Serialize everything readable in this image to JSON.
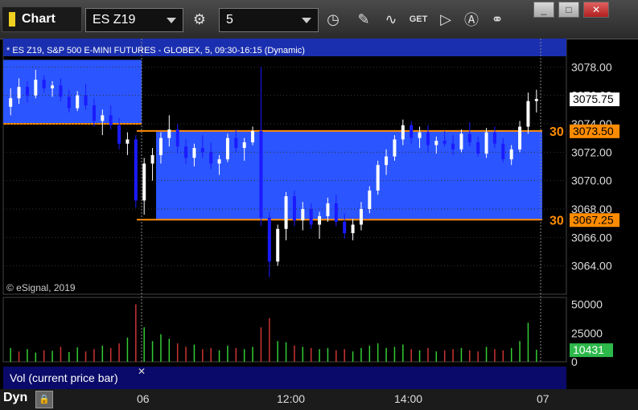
{
  "app": {
    "title": "Chart"
  },
  "toolbar": {
    "symbol": "ES Z19",
    "interval": "5",
    "window_buttons": [
      "_",
      "□",
      "✕"
    ]
  },
  "chart": {
    "description": "* ES Z19, S&P 500 E-MINI FUTURES - GLOBEX, 5, 09:30-16:15 (Dynamic)",
    "copyright": "© eSignal, 2019",
    "price_axis": {
      "ticks": [
        "3078.00",
        "3076.00",
        "3074.00",
        "3072.00",
        "3070.00",
        "3068.00",
        "3066.00",
        "3064.00"
      ],
      "min": 3062,
      "max": 3080
    },
    "current_price": "3075.75",
    "levels": [
      {
        "label": "30",
        "price": "3073.50",
        "value": 3073.5
      },
      {
        "label": "30",
        "price": "3067.25",
        "value": 3067.25
      }
    ],
    "volume_axis": {
      "ticks": [
        "50000",
        "25000",
        "0"
      ],
      "current": "10431"
    },
    "time_labels": [
      "06",
      "12:00",
      "14:00",
      "07"
    ],
    "colors": {
      "zone": "#2b55ff",
      "level": "#ff8c00",
      "up": "#ffffff",
      "down": "#1a1aff",
      "vol_up": "#3c3",
      "vol_down": "#c33"
    }
  },
  "chart_data": {
    "type": "candlestick",
    "candles": [
      [
        3075.2,
        3076.5,
        3074.6,
        3075.8
      ],
      [
        3075.8,
        3077.2,
        3075.4,
        3076.6
      ],
      [
        3076.6,
        3077.0,
        3075.5,
        3076.0
      ],
      [
        3076.0,
        3077.8,
        3075.8,
        3077.1
      ],
      [
        3077.1,
        3077.4,
        3076.2,
        3076.5
      ],
      [
        3076.5,
        3077.0,
        3075.9,
        3076.7
      ],
      [
        3076.7,
        3077.2,
        3075.6,
        3075.9
      ],
      [
        3075.9,
        3076.4,
        3074.8,
        3075.1
      ],
      [
        3075.1,
        3076.3,
        3074.9,
        3076.0
      ],
      [
        3076.0,
        3076.8,
        3075.0,
        3075.3
      ],
      [
        3075.3,
        3075.8,
        3073.8,
        3074.2
      ],
      [
        3074.2,
        3075.0,
        3073.2,
        3074.6
      ],
      [
        3074.6,
        3075.3,
        3073.6,
        3073.9
      ],
      [
        3073.9,
        3074.4,
        3072.2,
        3072.6
      ],
      [
        3072.6,
        3073.4,
        3071.8,
        3072.9
      ],
      [
        3072.9,
        3073.2,
        3068.1,
        3068.6
      ],
      [
        3068.6,
        3071.6,
        3067.6,
        3071.2
      ],
      [
        3071.2,
        3072.3,
        3070.0,
        3071.8
      ],
      [
        3071.8,
        3073.4,
        3071.2,
        3073.0
      ],
      [
        3073.0,
        3074.6,
        3072.4,
        3073.6
      ],
      [
        3073.6,
        3074.0,
        3071.9,
        3072.4
      ],
      [
        3072.4,
        3072.9,
        3071.2,
        3071.6
      ],
      [
        3071.6,
        3072.6,
        3071.0,
        3072.3
      ],
      [
        3072.3,
        3073.2,
        3071.6,
        3072.0
      ],
      [
        3072.0,
        3072.7,
        3070.8,
        3071.2
      ],
      [
        3071.2,
        3071.8,
        3070.4,
        3071.5
      ],
      [
        3071.5,
        3073.3,
        3071.3,
        3073.0
      ],
      [
        3073.0,
        3073.6,
        3072.0,
        3072.3
      ],
      [
        3072.3,
        3073.0,
        3071.4,
        3072.7
      ],
      [
        3072.7,
        3073.8,
        3072.5,
        3073.5
      ],
      [
        3073.5,
        3078.0,
        3066.8,
        3067.4
      ],
      [
        3067.4,
        3067.8,
        3063.2,
        3064.3
      ],
      [
        3064.3,
        3066.9,
        3064.0,
        3066.6
      ],
      [
        3066.6,
        3069.2,
        3065.8,
        3068.9
      ],
      [
        3068.9,
        3069.3,
        3066.8,
        3067.2
      ],
      [
        3067.2,
        3068.5,
        3066.5,
        3068.0
      ],
      [
        3068.0,
        3068.4,
        3066.6,
        3066.9
      ],
      [
        3066.9,
        3067.8,
        3065.9,
        3067.5
      ],
      [
        3067.5,
        3068.8,
        3067.1,
        3068.4
      ],
      [
        3068.4,
        3069.0,
        3066.8,
        3067.1
      ],
      [
        3067.1,
        3067.7,
        3065.9,
        3066.3
      ],
      [
        3066.3,
        3067.3,
        3065.8,
        3066.9
      ],
      [
        3066.9,
        3068.5,
        3066.5,
        3068.0
      ],
      [
        3068.0,
        3069.6,
        3067.7,
        3069.3
      ],
      [
        3069.3,
        3071.4,
        3069.0,
        3071.1
      ],
      [
        3071.1,
        3072.2,
        3070.4,
        3071.7
      ],
      [
        3071.7,
        3073.2,
        3071.4,
        3072.9
      ],
      [
        3072.9,
        3074.3,
        3072.5,
        3073.9
      ],
      [
        3073.9,
        3074.2,
        3072.6,
        3073.0
      ],
      [
        3073.0,
        3073.8,
        3072.3,
        3073.4
      ],
      [
        3073.4,
        3073.9,
        3072.0,
        3072.5
      ],
      [
        3072.5,
        3073.1,
        3071.9,
        3072.8
      ],
      [
        3072.8,
        3073.5,
        3072.4,
        3072.6
      ],
      [
        3072.6,
        3073.2,
        3071.8,
        3072.2
      ],
      [
        3072.2,
        3073.6,
        3072.0,
        3073.3
      ],
      [
        3073.3,
        3074.1,
        3072.4,
        3072.7
      ],
      [
        3072.7,
        3073.1,
        3071.7,
        3071.9
      ],
      [
        3071.9,
        3073.7,
        3071.6,
        3073.4
      ],
      [
        3073.4,
        3073.8,
        3072.3,
        3072.6
      ],
      [
        3072.6,
        3073.0,
        3071.3,
        3071.5
      ],
      [
        3071.5,
        3072.5,
        3071.1,
        3072.2
      ],
      [
        3072.2,
        3074.2,
        3072.0,
        3073.8
      ],
      [
        3073.8,
        3076.2,
        3073.3,
        3075.6
      ],
      [
        3075.6,
        3076.4,
        3074.8,
        3075.75
      ]
    ],
    "volume": [
      [
        12000,
        1
      ],
      [
        9000,
        0
      ],
      [
        11000,
        1
      ],
      [
        8000,
        1
      ],
      [
        10000,
        0
      ],
      [
        9500,
        1
      ],
      [
        13000,
        0
      ],
      [
        8500,
        1
      ],
      [
        12500,
        1
      ],
      [
        9000,
        0
      ],
      [
        11000,
        0
      ],
      [
        14000,
        1
      ],
      [
        12000,
        0
      ],
      [
        16000,
        0
      ],
      [
        21000,
        1
      ],
      [
        50000,
        0
      ],
      [
        30000,
        1
      ],
      [
        18000,
        1
      ],
      [
        24000,
        1
      ],
      [
        20000,
        1
      ],
      [
        16000,
        0
      ],
      [
        13000,
        0
      ],
      [
        15000,
        1
      ],
      [
        11000,
        0
      ],
      [
        12000,
        0
      ],
      [
        10000,
        1
      ],
      [
        14000,
        1
      ],
      [
        12000,
        0
      ],
      [
        11000,
        1
      ],
      [
        13000,
        1
      ],
      [
        30000,
        0
      ],
      [
        38000,
        0
      ],
      [
        18000,
        1
      ],
      [
        17000,
        1
      ],
      [
        14000,
        0
      ],
      [
        13000,
        1
      ],
      [
        12000,
        0
      ],
      [
        11000,
        1
      ],
      [
        12000,
        1
      ],
      [
        10000,
        0
      ],
      [
        11000,
        0
      ],
      [
        9000,
        1
      ],
      [
        12000,
        1
      ],
      [
        14000,
        1
      ],
      [
        16000,
        1
      ],
      [
        12000,
        1
      ],
      [
        13000,
        1
      ],
      [
        15000,
        1
      ],
      [
        11000,
        0
      ],
      [
        10000,
        1
      ],
      [
        12000,
        0
      ],
      [
        9000,
        1
      ],
      [
        10000,
        0
      ],
      [
        11000,
        0
      ],
      [
        12000,
        1
      ],
      [
        10000,
        0
      ],
      [
        9000,
        0
      ],
      [
        13000,
        1
      ],
      [
        11000,
        0
      ],
      [
        10000,
        0
      ],
      [
        12000,
        1
      ],
      [
        18000,
        1
      ],
      [
        34000,
        1
      ],
      [
        10431,
        1
      ]
    ],
    "ylim": [
      3062,
      3080
    ]
  }
}
